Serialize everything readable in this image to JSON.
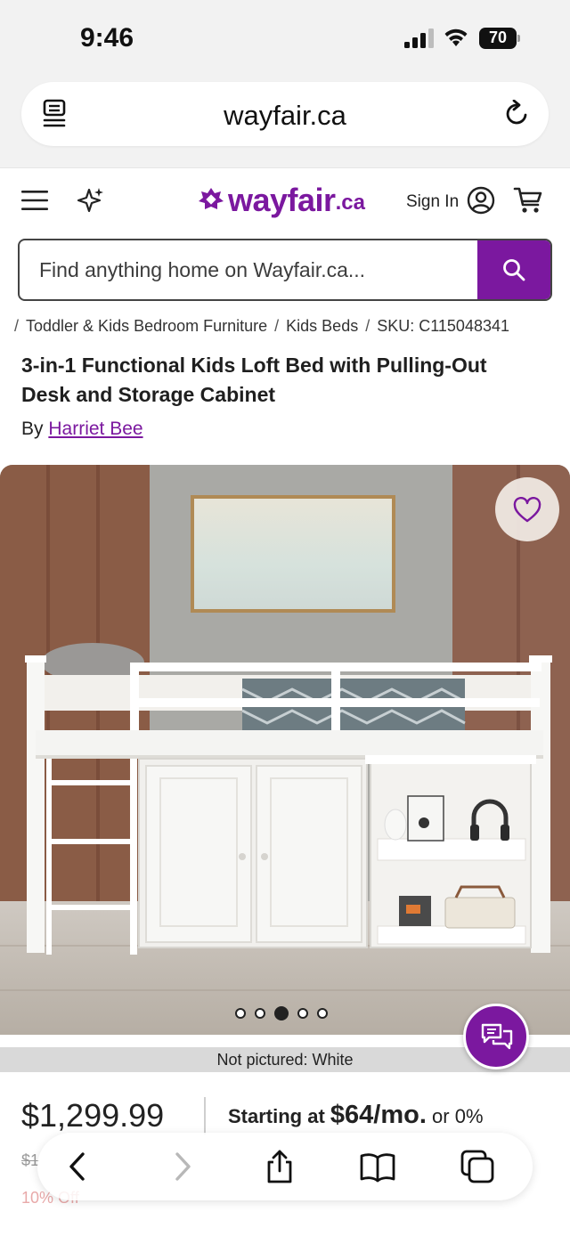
{
  "status_bar": {
    "time": "9:46",
    "battery": "70"
  },
  "browser": {
    "url": "wayfair.ca"
  },
  "header": {
    "logo_word": "wayfair",
    "logo_suffix": ".ca",
    "sign_in": "Sign In",
    "brand_color": "#7b189f"
  },
  "search": {
    "placeholder": "Find anything home on Wayfair.ca..."
  },
  "breadcrumb": {
    "items": [
      "Toddler & Kids Bedroom Furniture",
      "Kids Beds",
      "SKU: C115048341"
    ]
  },
  "product": {
    "title": "3-in-1 Functional Kids Loft Bed with Pulling-Out Desk and Storage Cabinet",
    "by_label": "By",
    "brand": "Harriet Bee",
    "not_pictured": "Not pictured: White",
    "image_count": 5,
    "active_image": 3
  },
  "pricing": {
    "price": "$1,299.99",
    "financing_prefix": "Starting at",
    "financing_amount": "$64/mo.",
    "financing_suffix": "or 0%",
    "old_price": "$1",
    "discount": "10% Off"
  },
  "icons": {
    "menu": "menu-icon",
    "sparkle": "sparkle-icon",
    "account": "account-icon",
    "cart": "cart-icon",
    "search": "search-icon",
    "favorite": "heart-icon",
    "chat": "chat-icon"
  }
}
